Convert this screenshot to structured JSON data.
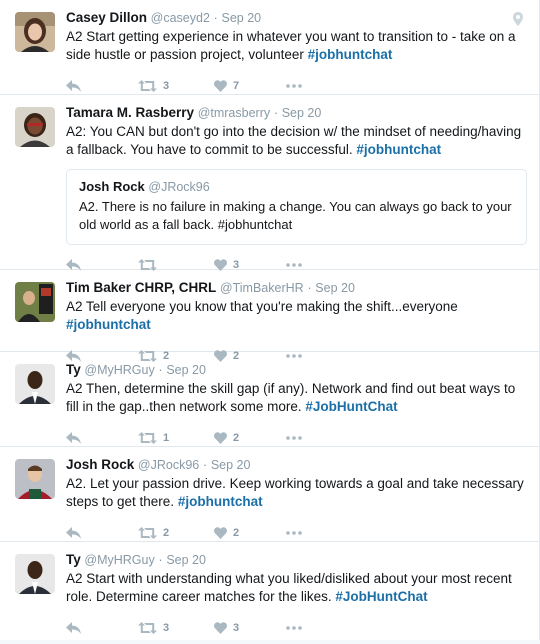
{
  "tweets": [
    {
      "fullname": "Casey Dillon",
      "username": "@caseyd2",
      "time": "Sep 20",
      "text_pre": "A2 Start getting experience in whatever you want to transition to - take on a side hustle or passion project, volunteer ",
      "hashtag": "#jobhuntchat",
      "retweets": "3",
      "likes": "7",
      "avatar_colors": [
        "#c9b59b",
        "#5a3b2a",
        "#e8c8b0"
      ]
    },
    {
      "fullname": "Tamara M. Rasberry",
      "username": "@tmrasberry",
      "time": "Sep 20",
      "text_pre": "A2: You CAN but don't go into the decision w/ the mindset of needing/having a fallback. You have to commit to be successful. ",
      "hashtag": "#jobhuntchat",
      "retweets": "",
      "likes": "3",
      "avatar_colors": [
        "#d7d2c8",
        "#3a2418",
        "#9c2b2b"
      ],
      "quote": {
        "fullname": "Josh Rock",
        "username": "@JRock96",
        "text": "A2. There is no failure in making a change. You can always go back to your old world as a fall back. #jobhuntchat"
      }
    },
    {
      "fullname": "Tim Baker CHRP, CHRL",
      "username": "@TimBakerHR",
      "time": "Sep 20",
      "text_pre": "A2 Tell everyone you know that you're making the shift...everyone ",
      "hashtag": "#jobhuntchat",
      "retweets": "2",
      "likes": "2",
      "avatar_colors": [
        "#6b7f3a",
        "#1d1d1d",
        "#b23a2a"
      ]
    },
    {
      "fullname": "Ty",
      "username": "@MyHRGuy",
      "time": "Sep 20",
      "text_pre": "A2 Then, determine the skill gap (if any).  Network and find out beat ways to fill in the gap..then network some more. ",
      "hashtag": "#JobHuntChat",
      "retweets": "1",
      "likes": "2",
      "avatar_colors": [
        "#e6e6e6",
        "#3b2618",
        "#2a2f3a"
      ]
    },
    {
      "fullname": "Josh Rock",
      "username": "@JRock96",
      "time": "Sep 20",
      "text_pre": "A2. Let your passion drive. Keep working towards a goal and take necessary steps to get there. ",
      "hashtag": "#jobhuntchat",
      "retweets": "2",
      "likes": "2",
      "avatar_colors": [
        "#b9bcc2",
        "#e8c7a8",
        "#a51d2b"
      ]
    },
    {
      "fullname": "Ty",
      "username": "@MyHRGuy",
      "time": "Sep 20",
      "text_pre": "A2 Start with understanding what you liked/disliked about your most recent role. Determine career matches for the likes. ",
      "hashtag": "#JobHuntChat",
      "retweets": "3",
      "likes": "3",
      "avatar_colors": [
        "#e6e6e6",
        "#3b2618",
        "#2a2f3a"
      ]
    }
  ]
}
